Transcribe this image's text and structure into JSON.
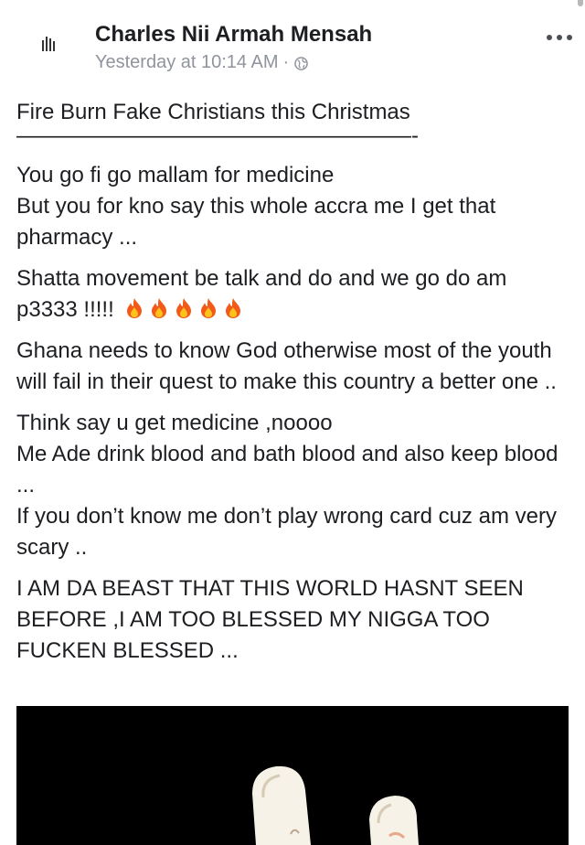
{
  "post": {
    "author": "Charles Nii Armah Mensah",
    "date": "Yesterday at 10:14 AM",
    "separator": "·",
    "privacy_icon": "globe-icon",
    "more_icon": "more-options-icon",
    "title": "Fire Burn Fake Christians this Christmas",
    "divider": "——————————————————-",
    "p1_line1": "You go fi go mallam for medicine",
    "p1_line2": "But you for kno say this whole accra me I get that pharmacy ...",
    "p2_text": "Shatta movement be talk and do and we go do am p3333 !!!!!",
    "p2_emoji_count": 5,
    "p3_text": "Ghana needs to know God otherwise most of the youth will fail in their quest to make this country a better one ..",
    "p4_line1": "Think say u get medicine ,noooo",
    "p4_line2": "Me Ade drink blood and bath blood and also keep blood ...",
    "p4_line3": "If you don’t know me don’t play wrong card cuz am very scary ..",
    "p5_text": "I AM DA BEAST THAT THIS WORLD HASNT SEEN BEFORE ,I AM TOO BLESSED MY NIGGA TOO FUCKEN BLESSED ..."
  },
  "colors": {
    "text": "#1c1e21",
    "meta": "#90949c",
    "fire_outer": "#f25a19",
    "fire_inner": "#ffc21a",
    "photo_bg": "#000000"
  }
}
